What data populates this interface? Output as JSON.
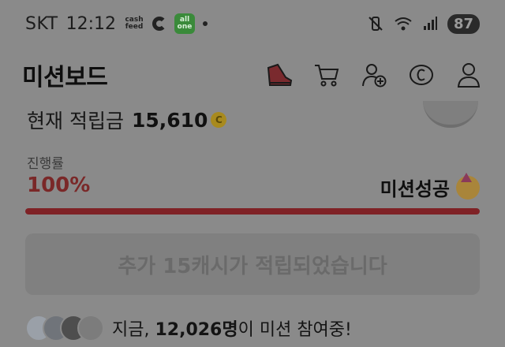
{
  "status_bar": {
    "carrier": "SKT",
    "time": "12:12",
    "cashfeed_top": "cash",
    "cashfeed_bottom": "feed",
    "allone_top": "all",
    "allone_bottom": "one",
    "battery": "87"
  },
  "header": {
    "title": "미션보드",
    "icons": [
      "shoe-icon",
      "cart-icon",
      "add-user-icon",
      "copyright-cash-icon",
      "profile-icon"
    ]
  },
  "points": {
    "label": "현재 적립금",
    "value": "15,610",
    "coin_symbol": "C"
  },
  "progress": {
    "label": "진행률",
    "percent_text": "100%",
    "fraction": 1.0,
    "status": "미션성공"
  },
  "claim_button": {
    "label": "추가 15캐시가 적립되었습니다"
  },
  "participants": {
    "prefix": "지금, ",
    "count": "12,026명",
    "suffix": "이 미션 참여중!"
  },
  "colors": {
    "overlay_bg": "#8a8a8a",
    "progress_fill": "#7f2226",
    "percent_text": "#7a2828"
  }
}
